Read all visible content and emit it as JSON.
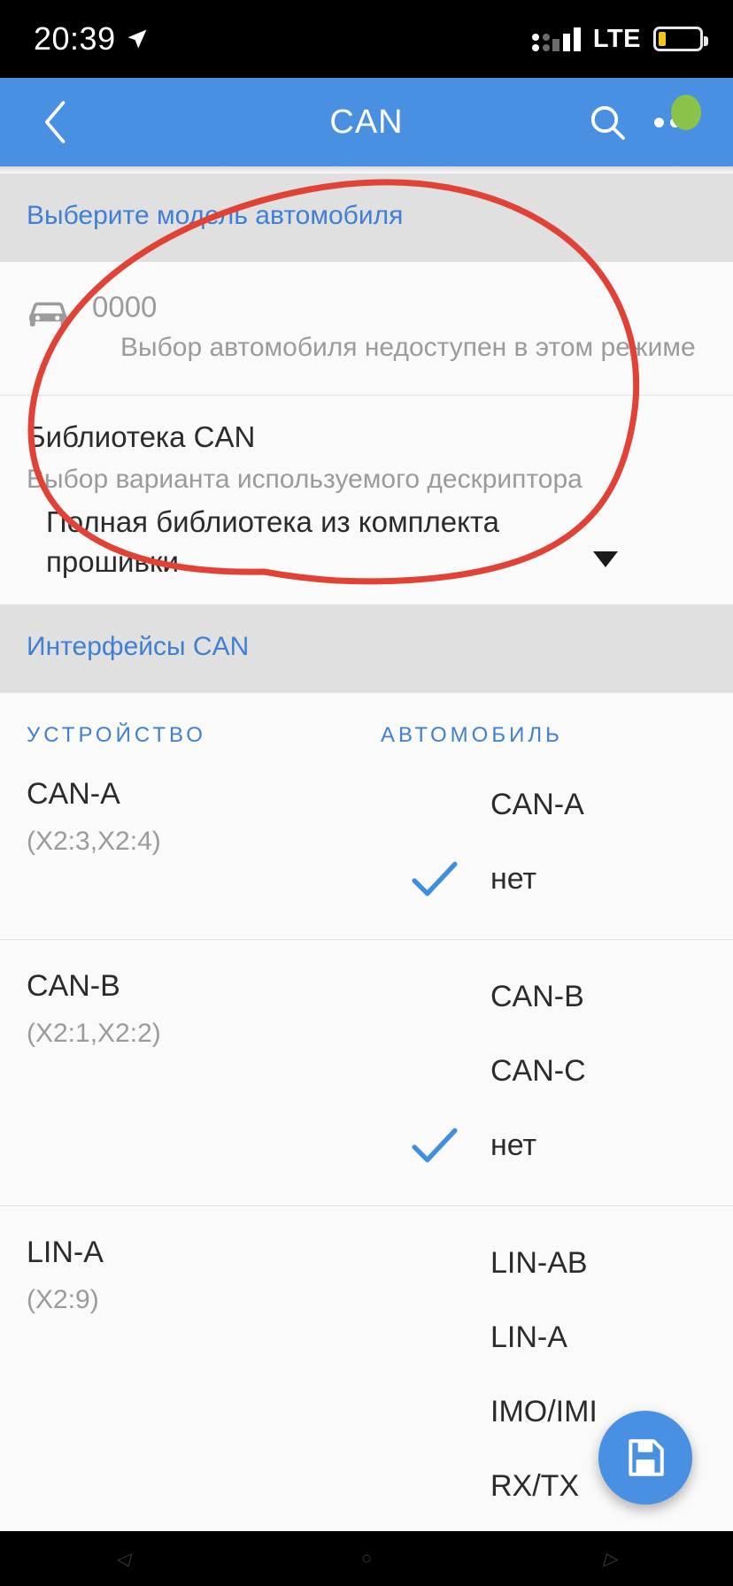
{
  "status_bar": {
    "time": "20:39",
    "location_icon": "location-arrow-icon",
    "network": "LTE",
    "signal_icon": "signal-strength-icon",
    "battery_icon": "battery-low-icon"
  },
  "app_bar": {
    "back_icon": "back-chevron-icon",
    "title": "CAN",
    "search_icon": "search-icon",
    "overflow_icon": "overflow-menu-icon",
    "accent_color": "#4a90e2",
    "badge_color": "#8bc34a"
  },
  "vehicle_section": {
    "header": "Выберите модель автомобиля",
    "car_icon": "car-icon",
    "code": "0000",
    "note": "Выбор автомобиля недоступен в этом режиме"
  },
  "library_section": {
    "title": "Библиотека CAN",
    "subtitle": "Выбор варианта используемого дескриптора",
    "selected_value": "Полная библиотека из комплекта прошивки",
    "caret_icon": "dropdown-caret-icon"
  },
  "interfaces_section": {
    "header": "Интерфейсы CAN",
    "columns": {
      "device": "УСТРОЙСТВО",
      "vehicle": "АВТОМОБИЛЬ"
    },
    "rows": [
      {
        "name": "CAN-A",
        "pins": "(X2:3,X2:4)",
        "options": [
          {
            "label": "CAN-A",
            "selected": false
          },
          {
            "label": "нет",
            "selected": true
          }
        ]
      },
      {
        "name": "CAN-B",
        "pins": "(X2:1,X2:2)",
        "options": [
          {
            "label": "CAN-B",
            "selected": false
          },
          {
            "label": "CAN-C",
            "selected": false
          },
          {
            "label": "нет",
            "selected": true
          }
        ]
      },
      {
        "name": "LIN-A",
        "pins": "(X2:9)",
        "options": [
          {
            "label": "LIN-AB",
            "selected": false
          },
          {
            "label": "LIN-A",
            "selected": false
          },
          {
            "label": "IMO/IMI",
            "selected": false
          },
          {
            "label": "RX/TX",
            "selected": false
          }
        ]
      }
    ],
    "check_color": "#3f8fe0"
  },
  "fab": {
    "icon": "save-floppy-icon",
    "color": "#4a90e2"
  },
  "annotation": {
    "type": "hand-drawn-ellipse",
    "color": "#e04236"
  },
  "nav_bar": {
    "back_icon": "nav-back-icon",
    "home_icon": "nav-home-icon",
    "recents_icon": "nav-recents-icon"
  }
}
